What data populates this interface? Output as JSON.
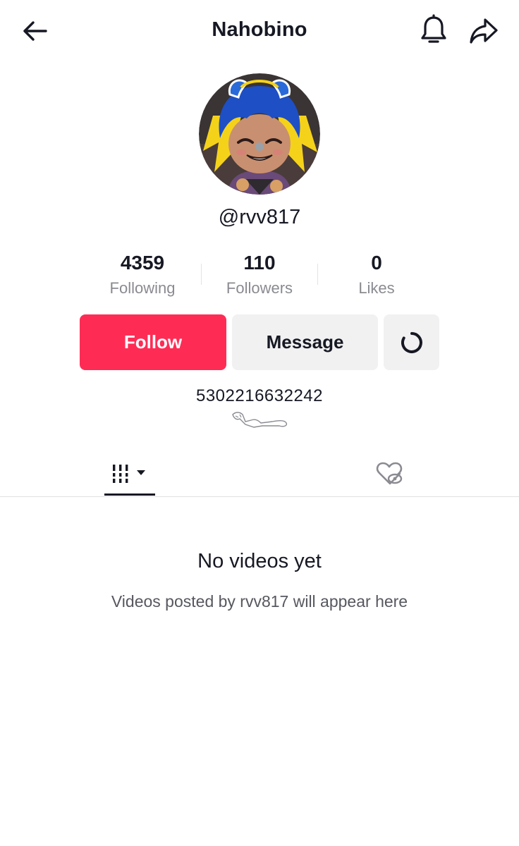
{
  "header": {
    "title": "Nahobino",
    "back_icon": "arrow-left-icon",
    "bell_icon": "bell-icon",
    "share_icon": "share-arrow-icon"
  },
  "profile": {
    "username": "@rvv817",
    "avatar": "cartoon-avatar-blue-hair"
  },
  "stats": [
    {
      "value": "4359",
      "label": "Following"
    },
    {
      "value": "110",
      "label": "Followers"
    },
    {
      "value": "0",
      "label": "Likes"
    }
  ],
  "actions": {
    "follow_label": "Follow",
    "message_label": "Message",
    "more_icon": "refresh-circle-icon"
  },
  "bio": {
    "text": "5302216632242"
  },
  "tabs": [
    {
      "name": "videos",
      "icon": "grid-bars-icon",
      "selected": true
    },
    {
      "name": "liked",
      "icon": "heart-eye-slash-icon",
      "selected": false
    }
  ],
  "empty_state": {
    "title": "No videos yet",
    "subtitle": "Videos posted by rvv817 will appear here"
  },
  "colors": {
    "accent": "#fe2c55",
    "secondary_button": "#f1f1f2",
    "text": "#161823",
    "muted": "#8a8b91"
  }
}
